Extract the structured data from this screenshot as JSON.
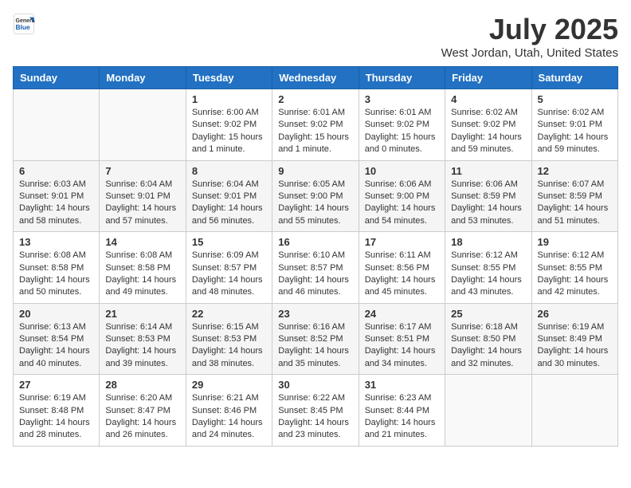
{
  "logo": {
    "general": "General",
    "blue": "Blue"
  },
  "title": "July 2025",
  "subtitle": "West Jordan, Utah, United States",
  "weekdays": [
    "Sunday",
    "Monday",
    "Tuesday",
    "Wednesday",
    "Thursday",
    "Friday",
    "Saturday"
  ],
  "weeks": [
    [
      {
        "day": "",
        "info": ""
      },
      {
        "day": "",
        "info": ""
      },
      {
        "day": "1",
        "info": "Sunrise: 6:00 AM\nSunset: 9:02 PM\nDaylight: 15 hours and 1 minute."
      },
      {
        "day": "2",
        "info": "Sunrise: 6:01 AM\nSunset: 9:02 PM\nDaylight: 15 hours and 1 minute."
      },
      {
        "day": "3",
        "info": "Sunrise: 6:01 AM\nSunset: 9:02 PM\nDaylight: 15 hours and 0 minutes."
      },
      {
        "day": "4",
        "info": "Sunrise: 6:02 AM\nSunset: 9:02 PM\nDaylight: 14 hours and 59 minutes."
      },
      {
        "day": "5",
        "info": "Sunrise: 6:02 AM\nSunset: 9:01 PM\nDaylight: 14 hours and 59 minutes."
      }
    ],
    [
      {
        "day": "6",
        "info": "Sunrise: 6:03 AM\nSunset: 9:01 PM\nDaylight: 14 hours and 58 minutes."
      },
      {
        "day": "7",
        "info": "Sunrise: 6:04 AM\nSunset: 9:01 PM\nDaylight: 14 hours and 57 minutes."
      },
      {
        "day": "8",
        "info": "Sunrise: 6:04 AM\nSunset: 9:01 PM\nDaylight: 14 hours and 56 minutes."
      },
      {
        "day": "9",
        "info": "Sunrise: 6:05 AM\nSunset: 9:00 PM\nDaylight: 14 hours and 55 minutes."
      },
      {
        "day": "10",
        "info": "Sunrise: 6:06 AM\nSunset: 9:00 PM\nDaylight: 14 hours and 54 minutes."
      },
      {
        "day": "11",
        "info": "Sunrise: 6:06 AM\nSunset: 8:59 PM\nDaylight: 14 hours and 53 minutes."
      },
      {
        "day": "12",
        "info": "Sunrise: 6:07 AM\nSunset: 8:59 PM\nDaylight: 14 hours and 51 minutes."
      }
    ],
    [
      {
        "day": "13",
        "info": "Sunrise: 6:08 AM\nSunset: 8:58 PM\nDaylight: 14 hours and 50 minutes."
      },
      {
        "day": "14",
        "info": "Sunrise: 6:08 AM\nSunset: 8:58 PM\nDaylight: 14 hours and 49 minutes."
      },
      {
        "day": "15",
        "info": "Sunrise: 6:09 AM\nSunset: 8:57 PM\nDaylight: 14 hours and 48 minutes."
      },
      {
        "day": "16",
        "info": "Sunrise: 6:10 AM\nSunset: 8:57 PM\nDaylight: 14 hours and 46 minutes."
      },
      {
        "day": "17",
        "info": "Sunrise: 6:11 AM\nSunset: 8:56 PM\nDaylight: 14 hours and 45 minutes."
      },
      {
        "day": "18",
        "info": "Sunrise: 6:12 AM\nSunset: 8:55 PM\nDaylight: 14 hours and 43 minutes."
      },
      {
        "day": "19",
        "info": "Sunrise: 6:12 AM\nSunset: 8:55 PM\nDaylight: 14 hours and 42 minutes."
      }
    ],
    [
      {
        "day": "20",
        "info": "Sunrise: 6:13 AM\nSunset: 8:54 PM\nDaylight: 14 hours and 40 minutes."
      },
      {
        "day": "21",
        "info": "Sunrise: 6:14 AM\nSunset: 8:53 PM\nDaylight: 14 hours and 39 minutes."
      },
      {
        "day": "22",
        "info": "Sunrise: 6:15 AM\nSunset: 8:53 PM\nDaylight: 14 hours and 38 minutes."
      },
      {
        "day": "23",
        "info": "Sunrise: 6:16 AM\nSunset: 8:52 PM\nDaylight: 14 hours and 35 minutes."
      },
      {
        "day": "24",
        "info": "Sunrise: 6:17 AM\nSunset: 8:51 PM\nDaylight: 14 hours and 34 minutes."
      },
      {
        "day": "25",
        "info": "Sunrise: 6:18 AM\nSunset: 8:50 PM\nDaylight: 14 hours and 32 minutes."
      },
      {
        "day": "26",
        "info": "Sunrise: 6:19 AM\nSunset: 8:49 PM\nDaylight: 14 hours and 30 minutes."
      }
    ],
    [
      {
        "day": "27",
        "info": "Sunrise: 6:19 AM\nSunset: 8:48 PM\nDaylight: 14 hours and 28 minutes."
      },
      {
        "day": "28",
        "info": "Sunrise: 6:20 AM\nSunset: 8:47 PM\nDaylight: 14 hours and 26 minutes."
      },
      {
        "day": "29",
        "info": "Sunrise: 6:21 AM\nSunset: 8:46 PM\nDaylight: 14 hours and 24 minutes."
      },
      {
        "day": "30",
        "info": "Sunrise: 6:22 AM\nSunset: 8:45 PM\nDaylight: 14 hours and 23 minutes."
      },
      {
        "day": "31",
        "info": "Sunrise: 6:23 AM\nSunset: 8:44 PM\nDaylight: 14 hours and 21 minutes."
      },
      {
        "day": "",
        "info": ""
      },
      {
        "day": "",
        "info": ""
      }
    ]
  ]
}
